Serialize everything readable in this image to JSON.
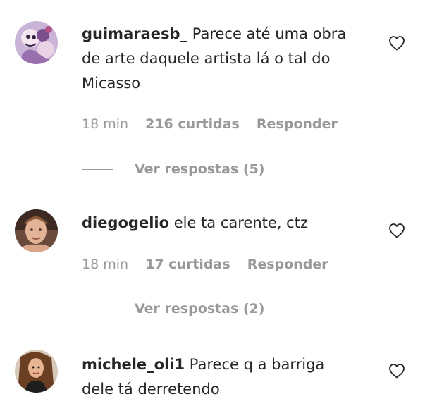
{
  "comments": [
    {
      "username": "guimaraesb_",
      "text": "Parece até uma obra de arte daquele artista lá o tal do Micasso",
      "time": "18 min",
      "likes": "216 curtidas",
      "reply_label": "Responder",
      "view_replies": "Ver respostas (5)",
      "avatar_icon": "cartoon-avatar"
    },
    {
      "username": "diegogelio",
      "text": "ele ta carente, ctz",
      "time": "18 min",
      "likes": "17 curtidas",
      "reply_label": "Responder",
      "view_replies": "Ver respostas (2)",
      "avatar_icon": "man-avatar"
    },
    {
      "username": "michele_oli1",
      "text": "Parece q a barriga dele tá derretendo",
      "avatar_icon": "woman-avatar"
    }
  ],
  "colors": {
    "text": "#262626",
    "muted": "#999999",
    "background": "#ffffff"
  }
}
